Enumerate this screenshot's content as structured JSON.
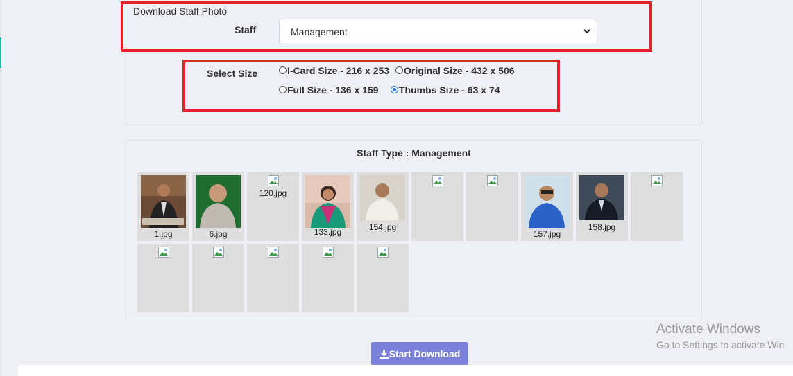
{
  "form": {
    "section_title": "Download Staff Photo",
    "staff_label": "Staff",
    "staff_value": "Management",
    "size_label": "Select Size",
    "size_options": [
      {
        "label": "I-Card Size - 216 x 253",
        "checked": false
      },
      {
        "label": "Original Size - 432 x 506",
        "checked": false
      },
      {
        "label": "Full Size - 136 x 159",
        "checked": false
      },
      {
        "label": "Thumbs Size - 63 x 74",
        "checked": true
      }
    ]
  },
  "gallery": {
    "title": "Staff Type : Management",
    "photos": [
      {
        "file": "1.jpg",
        "image": "photo"
      },
      {
        "file": "6.jpg",
        "image": "photo"
      },
      {
        "file": "120.jpg",
        "image": "broken"
      },
      {
        "file": "133.jpg",
        "image": "photo"
      },
      {
        "file": "154.jpg",
        "image": "photo"
      },
      {
        "file": "",
        "image": "broken"
      },
      {
        "file": "",
        "image": "broken"
      },
      {
        "file": "157.jpg",
        "image": "photo"
      },
      {
        "file": "158.jpg",
        "image": "photo"
      },
      {
        "file": "",
        "image": "broken"
      },
      {
        "file": "",
        "image": "broken"
      },
      {
        "file": "",
        "image": "broken"
      },
      {
        "file": "",
        "image": "broken"
      },
      {
        "file": "",
        "image": "broken"
      },
      {
        "file": "",
        "image": "broken"
      }
    ]
  },
  "actions": {
    "download_label": "Start Download",
    "download_icon": "download-icon"
  },
  "watermark": {
    "line1": "Activate Windows",
    "line2": "Go to Settings to activate Win"
  },
  "colors": {
    "highlight": "#e0242b",
    "button": "#7b80d8",
    "radio_checked": "#1a73e8"
  }
}
